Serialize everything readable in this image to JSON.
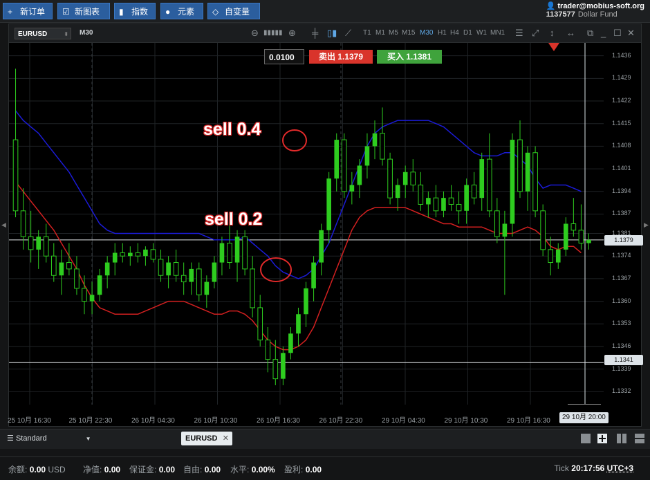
{
  "toolbar": {
    "new_order": "新订单",
    "new_chart": "新图表",
    "indicators": "指数",
    "elements": "元素",
    "variables": "自变量"
  },
  "account": {
    "user": "trader@mobius-soft.org",
    "number": "1137577",
    "fund": "Dollar Fund"
  },
  "chart": {
    "symbol": "EURUSD",
    "timeframe": "M30",
    "timeframes": [
      "T1",
      "M1",
      "M5",
      "M15",
      "M30",
      "H1",
      "H4",
      "D1",
      "W1",
      "MN1"
    ],
    "active_timeframe": "M30",
    "lot": "0.0100",
    "sell_label": "卖出 1.1379",
    "buy_label": "买入 1.1381",
    "price_tag_current": "1.1379",
    "price_tag_line": "1.1341",
    "cursor_time": "29 10月 20:00",
    "annotations": [
      "sell 0.4",
      "sell 0.2"
    ]
  },
  "chart_data": {
    "type": "candlestick",
    "symbol": "EURUSD",
    "timeframe": "M30",
    "y_ticks": [
      "1.1436",
      "1.1429",
      "1.1422",
      "1.1415",
      "1.1408",
      "1.1401",
      "1.1394",
      "1.1387",
      "1.1381",
      "1.1374",
      "1.1367",
      "1.1360",
      "1.1353",
      "1.1346",
      "1.1339",
      "1.1332"
    ],
    "x_ticks": [
      "25 10月 16:30",
      "25 10月 22:30",
      "26 10月 04:30",
      "26 10月 10:30",
      "26 10月 16:30",
      "26 10月 22:30",
      "29 10月 04:30",
      "29 10月 10:30",
      "29 10月 16:30"
    ],
    "ylim": [
      1.1328,
      1.144
    ],
    "horizontal_lines": [
      1.1379,
      1.1341
    ],
    "candles": [
      [
        1.141,
        1.1432,
        1.1386,
        1.1388
      ],
      [
        1.1388,
        1.1395,
        1.1376,
        1.138
      ],
      [
        1.138,
        1.1388,
        1.1372,
        1.1376
      ],
      [
        1.1376,
        1.1382,
        1.137,
        1.138
      ],
      [
        1.138,
        1.1384,
        1.1372,
        1.1374
      ],
      [
        1.1374,
        1.1378,
        1.1366,
        1.1368
      ],
      [
        1.1368,
        1.1376,
        1.1362,
        1.1372
      ],
      [
        1.1372,
        1.1378,
        1.1368,
        1.137
      ],
      [
        1.137,
        1.1374,
        1.1362,
        1.1364
      ],
      [
        1.1364,
        1.1368,
        1.1356,
        1.136
      ],
      [
        1.136,
        1.1366,
        1.1356,
        1.1362
      ],
      [
        1.1362,
        1.137,
        1.136,
        1.1368
      ],
      [
        1.1368,
        1.1374,
        1.1364,
        1.1372
      ],
      [
        1.1372,
        1.1378,
        1.1368,
        1.1375
      ],
      [
        1.1375,
        1.1378,
        1.1372,
        1.1374
      ],
      [
        1.1374,
        1.1377,
        1.1371,
        1.1375
      ],
      [
        1.1375,
        1.1378,
        1.1372,
        1.1374
      ],
      [
        1.1374,
        1.1377,
        1.1371,
        1.1376
      ],
      [
        1.1376,
        1.1378,
        1.1372,
        1.1373
      ],
      [
        1.1373,
        1.1376,
        1.1366,
        1.1368
      ],
      [
        1.1368,
        1.1374,
        1.1364,
        1.1372
      ],
      [
        1.1372,
        1.1376,
        1.1366,
        1.1368
      ],
      [
        1.1368,
        1.1372,
        1.1362,
        1.1366
      ],
      [
        1.1366,
        1.1372,
        1.1362,
        1.137
      ],
      [
        1.137,
        1.1372,
        1.136,
        1.1362
      ],
      [
        1.1362,
        1.1368,
        1.1358,
        1.1366
      ],
      [
        1.1366,
        1.1374,
        1.1364,
        1.1372
      ],
      [
        1.1372,
        1.138,
        1.1368,
        1.1378
      ],
      [
        1.1378,
        1.1384,
        1.137,
        1.1372
      ],
      [
        1.1372,
        1.1382,
        1.1366,
        1.138
      ],
      [
        1.138,
        1.1382,
        1.1368,
        1.137
      ],
      [
        1.137,
        1.1374,
        1.1355,
        1.1358
      ],
      [
        1.1358,
        1.1362,
        1.1346,
        1.1348
      ],
      [
        1.1348,
        1.1352,
        1.1338,
        1.1342
      ],
      [
        1.1342,
        1.1348,
        1.1334,
        1.1336
      ],
      [
        1.1336,
        1.1346,
        1.1334,
        1.1344
      ],
      [
        1.1344,
        1.1352,
        1.1342,
        1.135
      ],
      [
        1.135,
        1.1358,
        1.1346,
        1.1356
      ],
      [
        1.1356,
        1.1366,
        1.1352,
        1.1364
      ],
      [
        1.1364,
        1.1374,
        1.136,
        1.1372
      ],
      [
        1.1372,
        1.1384,
        1.1368,
        1.1382
      ],
      [
        1.1382,
        1.14,
        1.1378,
        1.1398
      ],
      [
        1.1398,
        1.1412,
        1.1394,
        1.141
      ],
      [
        1.141,
        1.1412,
        1.1392,
        1.1394
      ],
      [
        1.1394,
        1.14,
        1.139,
        1.1396
      ],
      [
        1.1396,
        1.1404,
        1.1392,
        1.1402
      ],
      [
        1.1402,
        1.1412,
        1.1398,
        1.1408
      ],
      [
        1.1408,
        1.1416,
        1.1404,
        1.1412
      ],
      [
        1.1412,
        1.142,
        1.1402,
        1.1404
      ],
      [
        1.1404,
        1.1406,
        1.139,
        1.1392
      ],
      [
        1.1392,
        1.1398,
        1.1388,
        1.1396
      ],
      [
        1.1396,
        1.1402,
        1.1392,
        1.14
      ],
      [
        1.14,
        1.1404,
        1.1394,
        1.1396
      ],
      [
        1.1396,
        1.14,
        1.1388,
        1.139
      ],
      [
        1.139,
        1.1394,
        1.1386,
        1.1392
      ],
      [
        1.1392,
        1.1396,
        1.1386,
        1.1388
      ],
      [
        1.1388,
        1.1394,
        1.1386,
        1.1392
      ],
      [
        1.1392,
        1.1396,
        1.1388,
        1.139
      ],
      [
        1.139,
        1.1394,
        1.1384,
        1.1388
      ],
      [
        1.1388,
        1.1398,
        1.1384,
        1.1396
      ],
      [
        1.1396,
        1.14,
        1.139,
        1.1392
      ],
      [
        1.1392,
        1.1406,
        1.1388,
        1.1404
      ],
      [
        1.1404,
        1.1412,
        1.1386,
        1.1388
      ],
      [
        1.1388,
        1.1392,
        1.1378,
        1.138
      ],
      [
        1.138,
        1.1388,
        1.1362,
        1.1384
      ],
      [
        1.1384,
        1.1412,
        1.138,
        1.141
      ],
      [
        1.141,
        1.1416,
        1.1392,
        1.1394
      ],
      [
        1.1394,
        1.1408,
        1.1388,
        1.1406
      ],
      [
        1.1406,
        1.1408,
        1.1386,
        1.1388
      ],
      [
        1.1388,
        1.139,
        1.1374,
        1.1376
      ],
      [
        1.1376,
        1.138,
        1.1368,
        1.1372
      ],
      [
        1.1372,
        1.1378,
        1.137,
        1.1376
      ],
      [
        1.1376,
        1.1386,
        1.1374,
        1.1384
      ],
      [
        1.1384,
        1.1392,
        1.138,
        1.1382
      ],
      [
        1.1382,
        1.139,
        1.1376,
        1.1378
      ],
      [
        1.1378,
        1.1381,
        1.1376,
        1.1379
      ]
    ],
    "series": [
      {
        "name": "",
        "color": "#1b1bd6",
        "values": [
          1.1419,
          1.1416,
          1.1414,
          1.1412,
          1.1409,
          1.1406,
          1.1403,
          1.14,
          1.1396,
          1.1392,
          1.1388,
          1.1384,
          1.1382,
          1.1381,
          1.1381,
          1.1381,
          1.1381,
          1.1381,
          1.1381,
          1.1381,
          1.1381,
          1.1381,
          1.1381,
          1.1381,
          1.1381,
          1.138,
          1.1379,
          1.1379,
          1.1379,
          1.1379,
          1.138,
          1.1378,
          1.1376,
          1.1374,
          1.1371,
          1.1369,
          1.1368,
          1.1367,
          1.1368,
          1.137,
          1.1374,
          1.1378,
          1.1384,
          1.139,
          1.1396,
          1.1402,
          1.1408,
          1.1412,
          1.1414,
          1.1415,
          1.1416,
          1.1416,
          1.1416,
          1.1416,
          1.1416,
          1.1415,
          1.1414,
          1.1412,
          1.141,
          1.1408,
          1.1406,
          1.1405,
          1.1405,
          1.1405,
          1.1406,
          1.1406,
          1.1404,
          1.1402,
          1.1398,
          1.1395,
          1.1396,
          1.1396,
          1.1396,
          1.1395,
          1.1394
        ]
      },
      {
        "name": "",
        "color": "#d42020",
        "values": [
          1.1397,
          1.1394,
          1.1391,
          1.1388,
          1.1385,
          1.1382,
          1.1378,
          1.1374,
          1.137,
          1.1365,
          1.1361,
          1.1358,
          1.1357,
          1.1356,
          1.1356,
          1.1356,
          1.1356,
          1.1357,
          1.1358,
          1.1359,
          1.136,
          1.136,
          1.136,
          1.1359,
          1.1358,
          1.1357,
          1.1356,
          1.1356,
          1.1357,
          1.1357,
          1.1356,
          1.1354,
          1.1351,
          1.1348,
          1.1346,
          1.1345,
          1.1345,
          1.1346,
          1.1348,
          1.1352,
          1.1358,
          1.1364,
          1.137,
          1.1376,
          1.1382,
          1.1386,
          1.1388,
          1.1389,
          1.1389,
          1.1389,
          1.1389,
          1.1389,
          1.1388,
          1.1387,
          1.1386,
          1.1385,
          1.1384,
          1.1384,
          1.1383,
          1.1383,
          1.1383,
          1.1383,
          1.1382,
          1.1381,
          1.1381,
          1.1381,
          1.1382,
          1.1383,
          1.1382,
          1.138,
          1.1377,
          1.1376,
          1.1377,
          1.1377,
          1.1375
        ]
      }
    ],
    "grid": true
  },
  "bottom": {
    "template": "Standard",
    "tab": "EURUSD"
  },
  "status": {
    "balance_label": "余额:",
    "balance": "0.00",
    "currency": "USD",
    "equity_label": "净值:",
    "equity": "0.00",
    "margin_label": "保证金:",
    "margin": "0.00",
    "free_label": "自由:",
    "free": "0.00",
    "level_label": "水平:",
    "level": "0.00%",
    "profit_label": "盈利:",
    "profit": "0.00",
    "tick_label": "Tick",
    "time": "20:17:56",
    "tz": "UTC+3"
  },
  "colors": {
    "accent": "#2b5e9e",
    "bull": "#2ecc1f",
    "sell": "#d9342b",
    "buy": "#3fa33c"
  }
}
